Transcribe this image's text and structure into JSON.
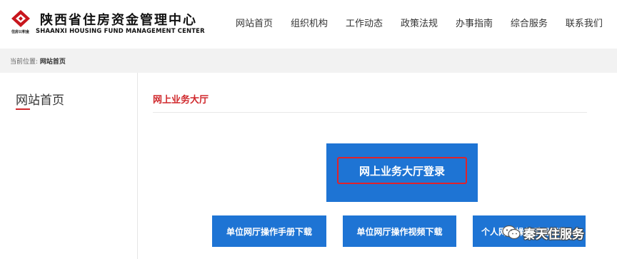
{
  "header": {
    "logo_cn": "陕西省住房资金管理中心",
    "logo_en": "SHAANXI HOUSING FUND MANAGEMENT CENTER",
    "logo_small": "住房公积金",
    "nav": [
      {
        "label": "网站首页"
      },
      {
        "label": "组织机构"
      },
      {
        "label": "工作动态"
      },
      {
        "label": "政策法规"
      },
      {
        "label": "办事指南"
      },
      {
        "label": "综合服务"
      },
      {
        "label": "联系我们"
      }
    ]
  },
  "breadcrumb": {
    "prefix": "当前位置:",
    "current": "网站首页"
  },
  "sidebar": {
    "title": "网站首页"
  },
  "main": {
    "section_title": "网上业务大厅",
    "login_button": "网上业务大厅登录",
    "downloads": [
      {
        "label": "单位网厅操作手册下载"
      },
      {
        "label": "单位网厅操作视频下载"
      },
      {
        "label": "个人网厅操作手册下载"
      }
    ]
  },
  "watermark": {
    "text": "秦天住服务",
    "icon": "wechat-icon"
  },
  "colors": {
    "accent_red": "#d0282c",
    "button_blue": "#1e74d4",
    "breadcrumb_bg": "#f2f2f2"
  }
}
